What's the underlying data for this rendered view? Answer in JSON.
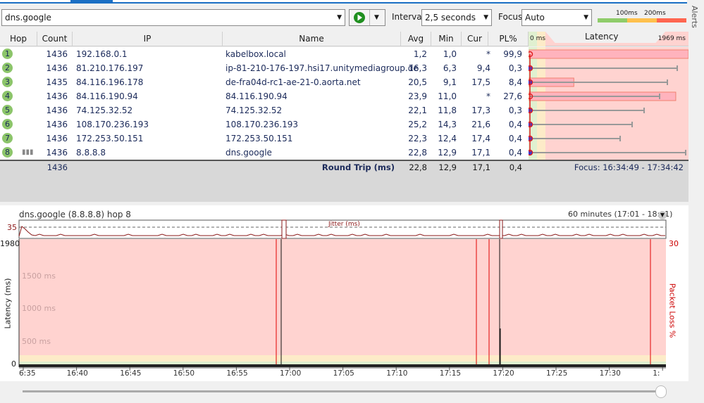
{
  "toolbar": {
    "target": "dns.google",
    "interval_label": "Interval",
    "interval_value": "2,5 seconds",
    "focus_label": "Focus",
    "focus_value": "Auto",
    "scale_100": "100ms",
    "scale_200": "200ms",
    "alerts": "Alerts"
  },
  "columns": {
    "hop": "Hop",
    "count": "Count",
    "ip": "IP",
    "name": "Name",
    "avg": "Avg",
    "min": "Min",
    "cur": "Cur",
    "pl": "PL%",
    "lat_min": "0 ms",
    "latency": "Latency",
    "lat_max": "1969 ms"
  },
  "hops": [
    {
      "hop": "1",
      "count": "1436",
      "ip": "192.168.0.1",
      "name": "kabelbox.local",
      "avg": "1,2",
      "min": "1,0",
      "cur": "*",
      "pl": "99,9"
    },
    {
      "hop": "2",
      "count": "1436",
      "ip": "81.210.176.197",
      "name": "ip-81-210-176-197.hsi17.unitymediagroup.de",
      "avg": "16,3",
      "min": "6,3",
      "cur": "9,4",
      "pl": "0,3"
    },
    {
      "hop": "3",
      "count": "1435",
      "ip": "84.116.196.178",
      "name": "de-fra04d-rc1-ae-21-0.aorta.net",
      "avg": "20,5",
      "min": "9,1",
      "cur": "17,5",
      "pl": "8,4"
    },
    {
      "hop": "4",
      "count": "1436",
      "ip": "84.116.190.94",
      "name": "84.116.190.94",
      "avg": "23,9",
      "min": "11,0",
      "cur": "*",
      "pl": "27,6"
    },
    {
      "hop": "5",
      "count": "1436",
      "ip": "74.125.32.52",
      "name": "74.125.32.52",
      "avg": "22,1",
      "min": "11,8",
      "cur": "17,3",
      "pl": "0,3"
    },
    {
      "hop": "6",
      "count": "1436",
      "ip": "108.170.236.193",
      "name": "108.170.236.193",
      "avg": "25,2",
      "min": "14,3",
      "cur": "21,6",
      "pl": "0,4"
    },
    {
      "hop": "7",
      "count": "1436",
      "ip": "172.253.50.151",
      "name": "172.253.50.151",
      "avg": "22,3",
      "min": "12,4",
      "cur": "17,4",
      "pl": "0,4"
    },
    {
      "hop": "8",
      "count": "1436",
      "ip": "8.8.8.8",
      "name": "dns.google",
      "avg": "22,8",
      "min": "12,9",
      "cur": "17,1",
      "pl": "0,4"
    }
  ],
  "summary": {
    "count": "1436",
    "label": "Round Trip (ms)",
    "avg": "22,8",
    "min": "12,9",
    "cur": "17,1",
    "pl": "0,4",
    "focus": "Focus: 16:34:49 - 17:34:42"
  },
  "graph": {
    "title": "dns.google (8.8.8.8) hop 8",
    "range": "60 minutes (17:01 - 18:01)",
    "jitter_max": "35",
    "jitter_label": "Jitter (ms)",
    "y_max": "1980",
    "y_zero": "0",
    "y_1500": "1500 ms",
    "y_1000": "1000 ms",
    "y_500": "500 ms",
    "ylabel": "Latency (ms)",
    "y2label": "Packet Loss %",
    "y2_max": "30",
    "xticks": [
      "6:35",
      "16:40",
      "16:45",
      "16:50",
      "16:55",
      "17:00",
      "17:05",
      "17:10",
      "17:15",
      "17:20",
      "17:25",
      "17:30",
      "1:"
    ]
  },
  "colors": {
    "good": "#8fcc6a",
    "warn": "#ffc04d",
    "bad": "#ff6650",
    "chart_bg": "#ffd3d0"
  }
}
